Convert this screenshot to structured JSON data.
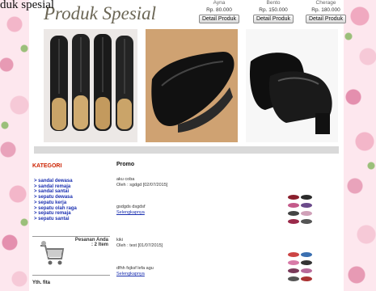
{
  "page_fragment_text": "duk spesial",
  "shop_title": "Produk Spesial",
  "products": [
    {
      "name": "Ayna",
      "price": "Rp. 80.000",
      "button": "Detail Produk"
    },
    {
      "name": "Bento",
      "price": "Rp. 150.000",
      "button": "Detail Produk"
    },
    {
      "name": "Cherage",
      "price": "Rp. 180.000",
      "button": "Detail Produk"
    }
  ],
  "kategori": {
    "title": "KATEGORI",
    "items": [
      "> sandal dewasa",
      "> sandal remaja",
      "> sandal santai",
      "> sepatu dewasa",
      "> sepatu kerja",
      "> sepatu olah raga",
      "> sepatu remaja",
      "> sepatu santai"
    ]
  },
  "cart": {
    "line1": "Pesanan Anda",
    "line2": ": 2 Item"
  },
  "greeting": "Yth. fita",
  "promo": {
    "title": "Promo",
    "items": [
      {
        "title": "aku coba",
        "meta": "Oleh : sgdgd [02/07/2015]"
      },
      {
        "title": "gsdgds dsgdsf",
        "link": "Selengkapnya"
      },
      {
        "title": "kiki",
        "meta": "Oleh : test [01/07/2015]"
      },
      {
        "title": "dfhh fsjksf lefa agu",
        "link": "Selengkapnya"
      }
    ]
  },
  "colors": {
    "kategori_title": "#cc2200",
    "link": "#1a2fb0",
    "shop_title": "#6b6655",
    "bar": "#d9d9d9"
  }
}
